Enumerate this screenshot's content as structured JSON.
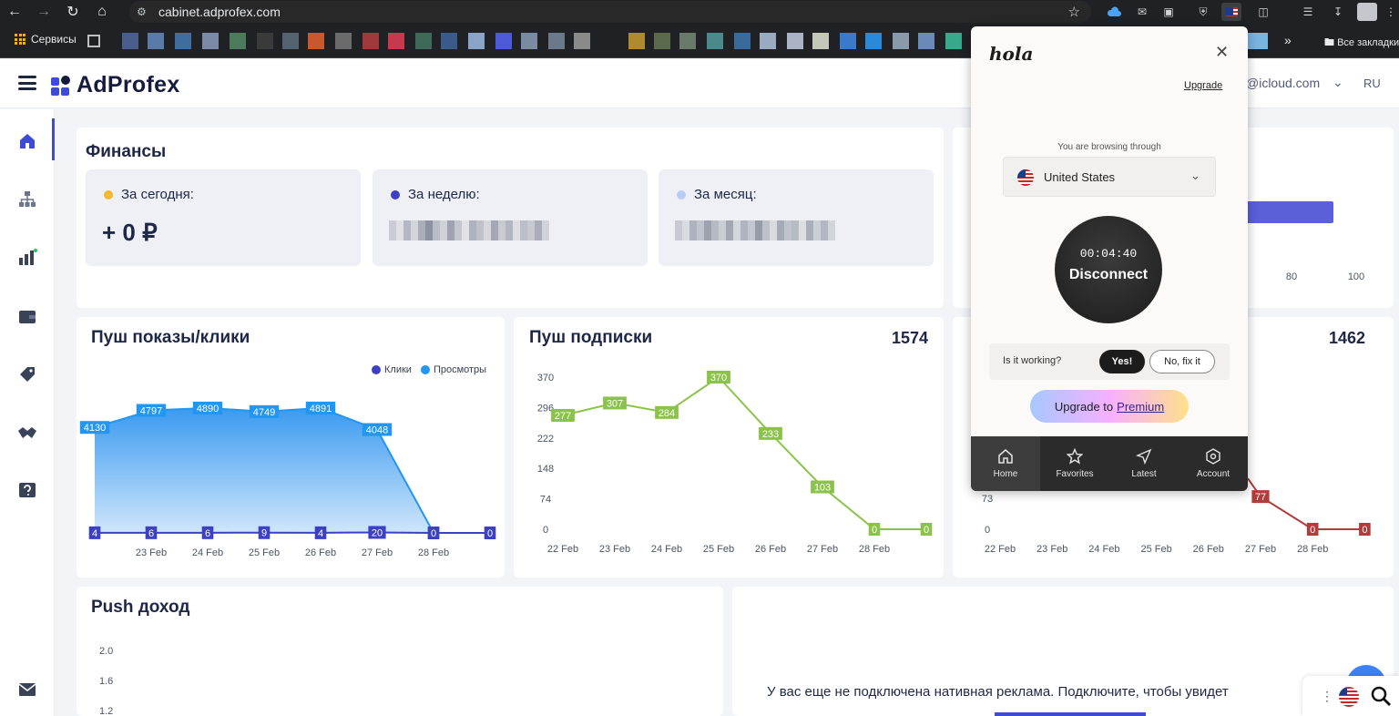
{
  "browser": {
    "url": "cabinet.adprofex.com",
    "bookmark_apps": "Сервисы",
    "bookmark_all": "Все закладки"
  },
  "header": {
    "logo": "AdProfex",
    "email": "@icloud.com",
    "lang": "RU"
  },
  "sidebar": {
    "items": [
      "home-icon",
      "sitemap-icon",
      "chart-icon",
      "wallet-icon",
      "tag-icon",
      "handshake-icon",
      "help-icon",
      "mail-icon"
    ]
  },
  "finance": {
    "title": "Финансы",
    "today_label": "За сегодня:",
    "today_value": "+ 0 ₽",
    "week_label": "За неделю:",
    "month_label": "За месяц:",
    "colors": {
      "today": "#f5b82e",
      "week": "#3d3fc4",
      "month": "#b8ccf4"
    }
  },
  "push_shows": {
    "title": "Пуш показы/клики",
    "legend_clicks": "Клики",
    "legend_views": "Просмотры",
    "chart_data": {
      "type": "area",
      "x": [
        "",
        "23 Feb",
        "24 Feb",
        "25 Feb",
        "26 Feb",
        "27 Feb",
        "28 Feb",
        ""
      ],
      "series": [
        {
          "name": "Просмотры",
          "values": [
            4130,
            4797,
            4890,
            4749,
            4891,
            4048,
            0,
            0
          ],
          "color": "#2196f3"
        },
        {
          "name": "Клики",
          "values": [
            4,
            6,
            6,
            9,
            4,
            20,
            0,
            0
          ],
          "color": "#3d3fc4"
        }
      ],
      "ylim": [
        0,
        5600
      ]
    }
  },
  "push_subs": {
    "title": "Пуш подписки",
    "total": "1574",
    "chart_data": {
      "type": "line",
      "x": [
        "22 Feb",
        "23 Feb",
        "24 Feb",
        "25 Feb",
        "26 Feb",
        "27 Feb",
        "28 Feb",
        ""
      ],
      "values": [
        277,
        307,
        284,
        370,
        233,
        103,
        0,
        0
      ],
      "yticks": [
        "0",
        "74",
        "148",
        "222",
        "296",
        "370"
      ],
      "ylim": [
        0,
        370
      ],
      "color": "#8bc34a"
    }
  },
  "third_card": {
    "total": "1462",
    "chart_data": {
      "type": "line",
      "x": [
        "22 Feb",
        "23 Feb",
        "24 Feb",
        "25 Feb",
        "26 Feb",
        "27 Feb",
        "28 Feb",
        ""
      ],
      "values": [
        null,
        null,
        null,
        null,
        null,
        77,
        0,
        0
      ],
      "yticks": [
        "0",
        "73"
      ],
      "color": "#b23b3b"
    },
    "bar_ticks": [
      "80",
      "100"
    ]
  },
  "push_income": {
    "title": "Push доход",
    "yticks": [
      "2.0",
      "1.6",
      "1.2"
    ]
  },
  "native": {
    "message": "У вас еще не подключена нативная реклама. Подключите, чтобы увидет"
  },
  "hola": {
    "logo": "hola",
    "upgrade": "Upgrade",
    "browsing_through": "You are browsing through",
    "country": "United States",
    "timer": "00:04:40",
    "disconnect": "Disconnect",
    "working_q": "Is it working?",
    "yes": "Yes!",
    "fix": "No, fix it",
    "premium_prefix": "Upgrade to",
    "premium_word": "Premium",
    "nav": [
      "Home",
      "Favorites",
      "Latest",
      "Account"
    ]
  }
}
